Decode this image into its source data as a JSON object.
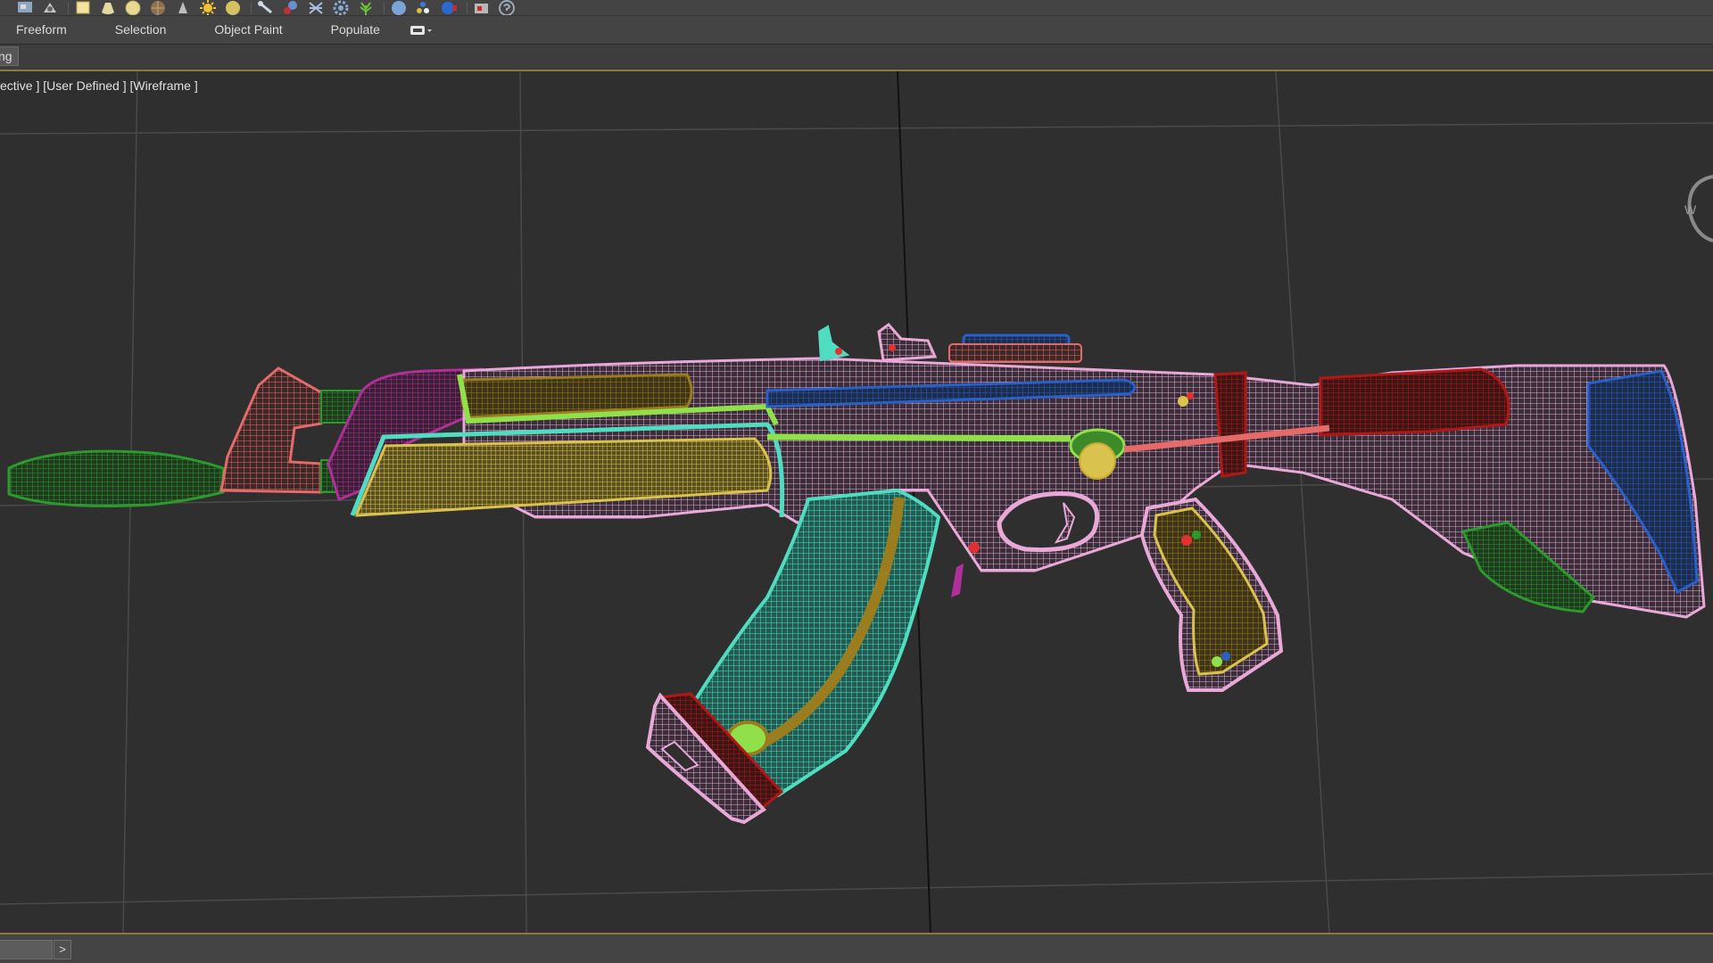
{
  "toolbar": {
    "icons": [
      {
        "name": "render-setup-icon"
      },
      {
        "name": "render-frame-icon"
      },
      {
        "name": "box-icon"
      },
      {
        "name": "cone-icon"
      },
      {
        "name": "sphere-icon"
      },
      {
        "name": "geosphere-icon"
      },
      {
        "name": "spotlight-icon"
      },
      {
        "name": "sun-light-icon"
      },
      {
        "name": "omni-light-icon"
      },
      {
        "name": "bone-icon"
      },
      {
        "name": "biped-icon"
      },
      {
        "name": "space-warp-icon"
      },
      {
        "name": "gear-icon"
      },
      {
        "name": "foliage-icon"
      },
      {
        "name": "material-sphere-icon"
      },
      {
        "name": "particles-icon"
      },
      {
        "name": "render-icon"
      },
      {
        "name": "layer-manager-icon"
      },
      {
        "name": "help-icon"
      }
    ]
  },
  "ribbon": {
    "tabs": [
      "Freeform",
      "Selection",
      "Object Paint",
      "Populate"
    ]
  },
  "subribbon": {
    "tab_label": "ng"
  },
  "viewport": {
    "label": "ective ] [User Defined ] [Wireframe ]",
    "viewcube_label": "W",
    "background": "#2f2f2f",
    "grid_color": "#4a4a4a",
    "grid_axis_color": "#111111",
    "wire_colors": {
      "pink": "#e8a8d8",
      "green": "#2d9a2d",
      "salmon": "#e56a6a",
      "magenta": "#b0309a",
      "yellow": "#d9c24e",
      "olive": "#9a7d1e",
      "cyan": "#4fdcc0",
      "lime": "#8fe04a",
      "blue": "#2a60c8",
      "darkred": "#b01818",
      "red": "#e03030"
    }
  },
  "statusbar": {
    "next_button": ">"
  }
}
